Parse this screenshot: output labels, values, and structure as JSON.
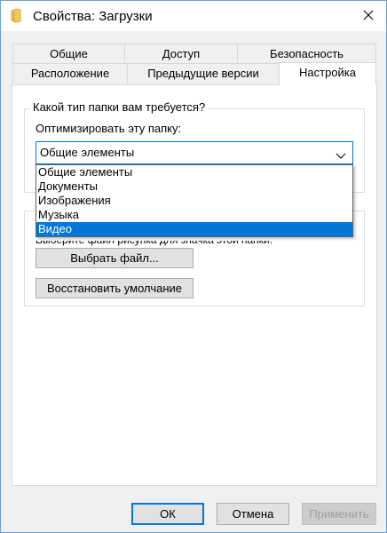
{
  "window": {
    "title": "Свойства: Загрузки"
  },
  "tabs": {
    "row1": [
      "Общие",
      "Доступ",
      "Безопасность"
    ],
    "row2": [
      "Расположение",
      "Предыдущие версии",
      "Настройка"
    ]
  },
  "section": {
    "group_title": "Какой тип папки вам требуется?",
    "optimize_label": "Оптимизировать эту папку:",
    "combo_value": "Общие элементы",
    "options": [
      "Общие элементы",
      "Документы",
      "Изображения",
      "Музыка",
      "Видео"
    ],
    "selected_option": "Видео"
  },
  "picture_group": {
    "hidden_text": "Выберите файл рисунка для значка этой папки:",
    "choose_file": "Выбрать файл...",
    "restore_default": "Восстановить умолчание"
  },
  "buttons": {
    "ok": "ОК",
    "cancel": "Отмена",
    "apply": "Применить"
  },
  "colors": {
    "accent": "#0078d7",
    "folder": "#f4c95d"
  }
}
